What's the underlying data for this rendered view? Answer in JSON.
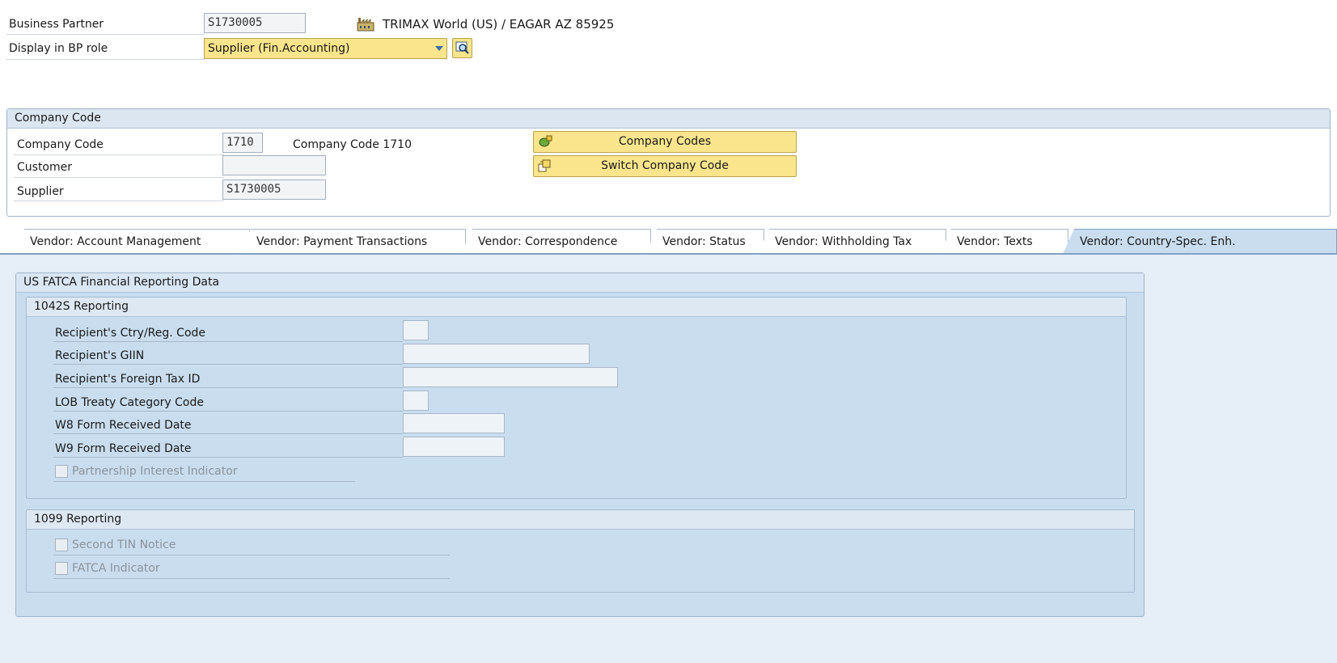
{
  "header": {
    "bp_label": "Business Partner",
    "bp_value": "S1730005",
    "bp_description": "TRIMAX World (US) / EAGAR AZ 85925",
    "role_label": "Display in BP role",
    "role_value": "Supplier (Fin.Accounting)"
  },
  "company_code_group": {
    "title": "Company Code",
    "rows": [
      {
        "label": "Company Code",
        "value": "1710",
        "description": "Company Code 1710"
      },
      {
        "label": "Customer",
        "value": ""
      },
      {
        "label": "Supplier",
        "value": "S1730005"
      }
    ],
    "buttons": {
      "company_codes": "Company Codes",
      "switch_company_code": "Switch Company Code"
    }
  },
  "tabs": [
    {
      "label": "Vendor: Account Management",
      "active": false
    },
    {
      "label": "Vendor: Payment Transactions",
      "active": false
    },
    {
      "label": "Vendor: Correspondence",
      "active": false
    },
    {
      "label": "Vendor: Status",
      "active": false
    },
    {
      "label": "Vendor: Withholding Tax",
      "active": false
    },
    {
      "label": "Vendor: Texts",
      "active": false
    },
    {
      "label": "Vendor: Country-Spec. Enh.",
      "active": true
    }
  ],
  "fatca": {
    "title": "US FATCA Financial Reporting Data",
    "section_1042s": {
      "title": "1042S Reporting",
      "fields": [
        {
          "label": "Recipient's Ctry/Reg. Code",
          "value": ""
        },
        {
          "label": "Recipient's GIIN",
          "value": ""
        },
        {
          "label": "Recipient's Foreign Tax ID",
          "value": ""
        },
        {
          "label": "LOB Treaty Category Code",
          "value": ""
        },
        {
          "label": "W8 Form Received Date",
          "value": ""
        },
        {
          "label": "W9 Form Received Date",
          "value": ""
        }
      ],
      "checkbox_partnership": "Partnership Interest Indicator"
    },
    "section_1099": {
      "title": "1099 Reporting",
      "checkbox_second_tin": "Second TIN Notice",
      "checkbox_fatca": "FATCA Indicator"
    }
  },
  "colors": {
    "accent_yellow": "#fbe58c",
    "panel_blue": "#c9ddef",
    "border_blue": "#9fb5ca"
  }
}
